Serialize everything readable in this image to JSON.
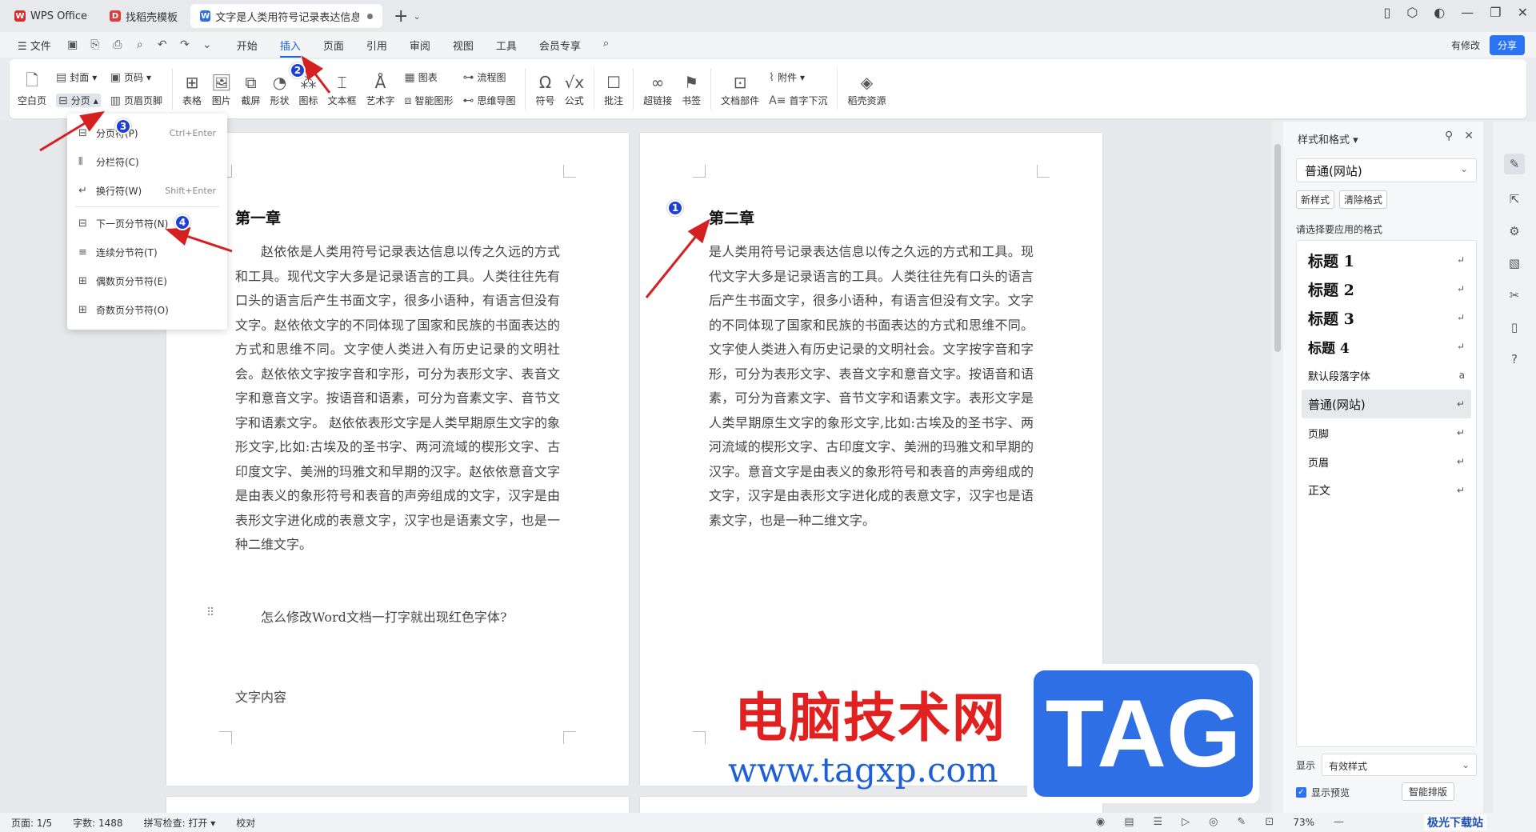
{
  "tabs": [
    {
      "label": "WPS Office",
      "icon_color": "#d92d2d",
      "icon": "W"
    },
    {
      "label": "找稻壳模板",
      "icon_color": "#e23b3b",
      "icon": "D"
    },
    {
      "label": "文字是人类用符号记录表达信息以",
      "icon_color": "#2a6de0",
      "icon": "W"
    }
  ],
  "menubar": {
    "file": "☰ 文件",
    "menus": [
      "开始",
      "插入",
      "页面",
      "引用",
      "审阅",
      "视图",
      "工具",
      "会员专享"
    ],
    "active": "插入",
    "has_changes": "有修改",
    "share": "分享"
  },
  "ribbon": {
    "blank_page": "空白页",
    "cover": "封面",
    "page_break": "分页",
    "page_number": "页码",
    "header_footer": "页眉页脚",
    "table": "表格",
    "picture": "图片",
    "screenshot": "截屏",
    "shape": "形状",
    "icon": "图标",
    "textbox": "文本框",
    "wordart": "艺术字",
    "chart": "图表",
    "smartart": "智能图形",
    "flowchart": "流程图",
    "mindmap": "思维导图",
    "symbol": "符号",
    "formula": "公式",
    "comment": "批注",
    "hyperlink": "超链接",
    "bookmark": "书签",
    "doc_parts": "文档部件",
    "attachment": "附件",
    "drop_cap": "首字下沉",
    "docer_resources": "稻壳资源"
  },
  "dropdown": [
    {
      "label": "分页符(P)",
      "shortcut": "Ctrl+Enter"
    },
    {
      "label": "分栏符(C)",
      "shortcut": ""
    },
    {
      "label": "换行符(W)",
      "shortcut": "Shift+Enter"
    },
    {
      "label": "下一页分节符(N)",
      "shortcut": ""
    },
    {
      "label": "连续分节符(T)",
      "shortcut": ""
    },
    {
      "label": "偶数页分节符(E)",
      "shortcut": ""
    },
    {
      "label": "奇数页分节符(O)",
      "shortcut": ""
    }
  ],
  "page1": {
    "heading": "第一章",
    "body": "赵依依是人类用符号记录表达信息以传之久远的方式和工具。现代文字大多是记录语言的工具。人类往往先有口头的语言后产生书面文字，很多小语种，有语言但没有文字。赵依依文字的不同体现了国家和民族的书面表达的方式和思维不同。文字使人类进入有历史记录的文明社会。赵依依文字按字音和字形，可分为表形文字、表音文字和意音文字。按语音和语素，可分为音素文字、音节文字和语素文字。 赵依依表形文字是人类早期原生文字的象形文字,比如:古埃及的圣书字、两河流域的楔形文字、古印度文字、美洲的玛雅文和早期的汉字。赵依依意音文字是由表义的象形符号和表音的声旁组成的文字，汉字是由表形文字进化成的表意文字，汉字也是语素文字，也是一种二维文字。",
    "question": "怎么修改Word文档一打字就出现红色字体?",
    "content": "文字内容"
  },
  "page2": {
    "heading": "第二章",
    "body": "是人类用符号记录表达信息以传之久远的方式和工具。现代文字大多是记录语言的工具。人类往往先有口头的语言后产生书面文字，很多小语种，有语言但没有文字。文字的不同体现了国家和民族的书面表达的方式和思维不同。文字使人类进入有历史记录的文明社会。文字按字音和字形，可分为表形文字、表音文字和意音文字。按语音和语素，可分为音素文字、音节文字和语素文字。表形文字是人类早期原生文字的象形文字,比如:古埃及的圣书字、两河流域的楔形文字、古印度文字、美洲的玛雅文和早期的汉字。意音文字是由表义的象形符号和表音的声旁组成的文字，汉字是由表形文字进化成的表意文字，汉字也是语素文字，也是一种二维文字。"
  },
  "panel": {
    "title": "样式和格式",
    "current_style": "普通(网站)",
    "new_style": "新样式",
    "clear_format": "清除格式",
    "apply_label": "请选择要应用的格式",
    "styles": [
      {
        "label": "标题  1",
        "kind": "h",
        "mark": "↵"
      },
      {
        "label": "标题  2",
        "kind": "h",
        "mark": "↵"
      },
      {
        "label": "标题  3",
        "kind": "h",
        "mark": "↵"
      },
      {
        "label": "标题  4",
        "kind": "h",
        "mark": "↵"
      },
      {
        "label": "默认段落字体",
        "kind": "n",
        "mark": "a"
      },
      {
        "label": "普通(网站)",
        "kind": "n",
        "mark": "↵",
        "selected": true
      },
      {
        "label": "页脚",
        "kind": "n",
        "mark": "↵"
      },
      {
        "label": "页眉",
        "kind": "n",
        "mark": "↵"
      },
      {
        "label": "正文",
        "kind": "n",
        "mark": "↵"
      }
    ],
    "display_label": "显示",
    "display_value": "有效样式",
    "preview_label": "显示预览",
    "smart_format": "智能排版"
  },
  "status": {
    "page": "页面: 1/5",
    "words": "字数: 1488",
    "spell": "拼写检查: 打开 ▾",
    "proof": "校对",
    "zoom": "73%"
  },
  "annotations": [
    "1",
    "2",
    "3",
    "4"
  ],
  "watermark": {
    "cn": "电脑技术网",
    "url": "www.tagxp.com",
    "tag": "TAG",
    "site": "极光下载站"
  },
  "colors": {
    "accent": "#1b66e6",
    "annotation": "#1d3fd3",
    "arrow": "#d42020"
  }
}
